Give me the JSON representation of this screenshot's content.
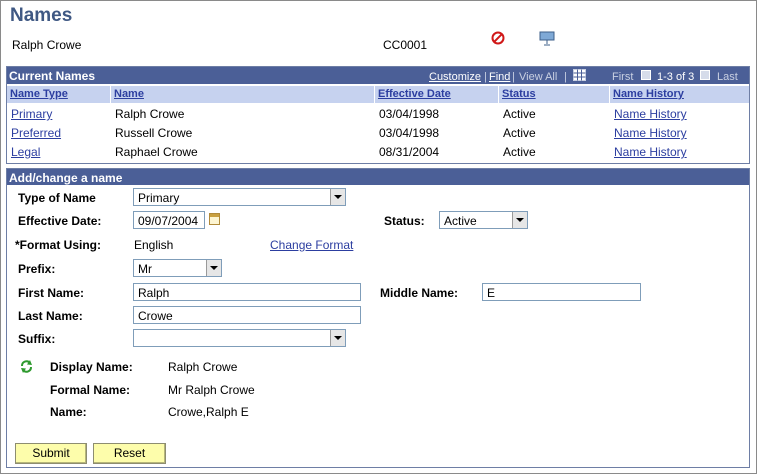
{
  "page": {
    "title": "Names",
    "person_name": "Ralph Crowe",
    "person_id": "CC0001"
  },
  "grid": {
    "caption": "Current Names",
    "nav": {
      "customize": "Customize",
      "sep1": "|",
      "find": "Find",
      "sep2": "|",
      "view_all": "View All",
      "sep3": "|",
      "first": "First",
      "range": "1-3 of 3",
      "last": "Last"
    },
    "columns": [
      "Name Type",
      "Name",
      "Effective Date",
      "Status",
      "Name History"
    ],
    "rows": [
      {
        "type": "Primary",
        "name": "Ralph Crowe",
        "date": "03/04/1998",
        "status": "Active",
        "history": "Name History"
      },
      {
        "type": "Preferred",
        "name": "Russell Crowe",
        "date": "03/04/1998",
        "status": "Active",
        "history": "Name History"
      },
      {
        "type": "Legal",
        "name": "Raphael Crowe",
        "date": "08/31/2004",
        "status": "Active",
        "history": "Name History"
      }
    ]
  },
  "form": {
    "caption": "Add/change a name",
    "type_of_name": {
      "label": "Type of Name",
      "value": "Primary"
    },
    "effective_date": {
      "label": "Effective Date:",
      "value": "09/07/2004"
    },
    "status": {
      "label": "Status:",
      "value": "Active"
    },
    "format_using": {
      "label": "*Format Using:",
      "value": "English",
      "link": "Change Format"
    },
    "prefix": {
      "label": "Prefix:",
      "value": "Mr"
    },
    "first_name": {
      "label": "First Name:",
      "value": "Ralph"
    },
    "middle_name": {
      "label": "Middle Name:",
      "value": "E"
    },
    "last_name": {
      "label": "Last Name:",
      "value": "Crowe"
    },
    "suffix": {
      "label": "Suffix:",
      "value": ""
    },
    "display_name": {
      "label": "Display Name:",
      "value": "Ralph Crowe"
    },
    "formal_name": {
      "label": "Formal Name:",
      "value": "Mr Ralph Crowe"
    },
    "name": {
      "label": "Name:",
      "value": "Crowe,Ralph E"
    },
    "submit": "Submit",
    "reset": "Reset"
  },
  "colors": {
    "header_bg": "#4b5f97",
    "column_header_bg": "#c6d2ef",
    "link": "#2c3ea0",
    "title": "#3f5883",
    "button_bg": "#fdfdab"
  },
  "icons": [
    "no-entry-icon",
    "presentation-icon",
    "spreadsheet-icon",
    "calendar-icon",
    "refresh-icon"
  ]
}
